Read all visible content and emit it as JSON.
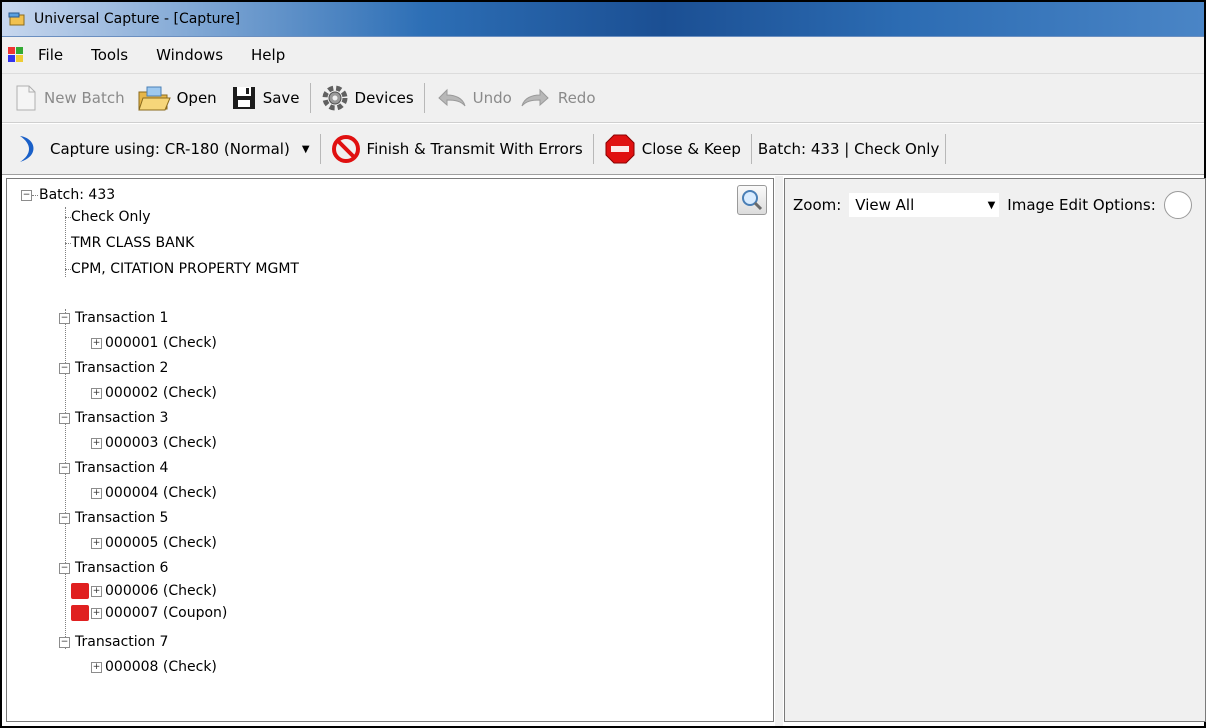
{
  "window": {
    "title": "Universal Capture - [Capture]"
  },
  "menu": [
    "File",
    "Tools",
    "Windows",
    "Help"
  ],
  "toolbar1": {
    "new_batch": "New Batch",
    "open": "Open",
    "save": "Save",
    "devices": "Devices",
    "undo": "Undo",
    "redo": "Redo"
  },
  "toolbar2": {
    "capture_using": "Capture using: CR-180 (Normal)",
    "finish_transmit": "Finish & Transmit With Errors",
    "close_keep": "Close & Keep",
    "batch_info": "Batch: 433 |  Check Only"
  },
  "tree": {
    "batch": "Batch: 433",
    "batch_children": [
      "Check Only",
      "TMR CLASS BANK",
      "CPM, CITATION PROPERTY MGMT"
    ],
    "transactions": [
      {
        "label": "Transaction 1",
        "items": [
          {
            "label": "000001  (Check)",
            "error": false
          }
        ]
      },
      {
        "label": "Transaction 2",
        "items": [
          {
            "label": "000002  (Check)",
            "error": false
          }
        ]
      },
      {
        "label": "Transaction 3",
        "items": [
          {
            "label": "000003  (Check)",
            "error": false
          }
        ]
      },
      {
        "label": "Transaction 4",
        "items": [
          {
            "label": "000004  (Check)",
            "error": false
          }
        ]
      },
      {
        "label": "Transaction 5",
        "items": [
          {
            "label": "000005  (Check)",
            "error": false
          }
        ]
      },
      {
        "label": "Transaction 6",
        "items": [
          {
            "label": "000006  (Check)",
            "error": true
          },
          {
            "label": "000007  (Coupon)",
            "error": true
          }
        ]
      },
      {
        "label": "Transaction 7",
        "items": [
          {
            "label": "000008  (Check)",
            "error": false
          }
        ]
      }
    ]
  },
  "viewer": {
    "zoom_label": "Zoom:",
    "zoom_value": "View All",
    "image_edit_label": "Image Edit Options:"
  },
  "colors": {
    "error": "#e02020",
    "title_blue": "#1b4f93"
  }
}
